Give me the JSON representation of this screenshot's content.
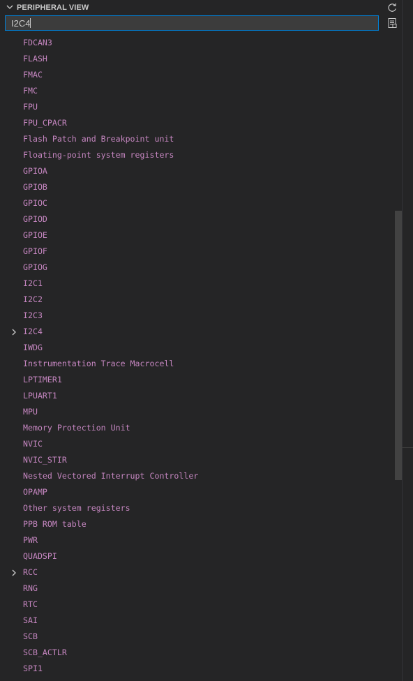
{
  "panel": {
    "title": "PERIPHERAL VIEW",
    "actions": {
      "refresh_icon": "refresh-icon",
      "filter_options_icon": "filter-options-icon"
    }
  },
  "filter": {
    "value": "I2C4",
    "placeholder": ""
  },
  "tree": {
    "items": [
      {
        "label": "FDCAN3",
        "expandable": false
      },
      {
        "label": "FLASH",
        "expandable": false
      },
      {
        "label": "FMAC",
        "expandable": false
      },
      {
        "label": "FMC",
        "expandable": false
      },
      {
        "label": "FPU",
        "expandable": false
      },
      {
        "label": "FPU_CPACR",
        "expandable": false
      },
      {
        "label": "Flash Patch and Breakpoint unit",
        "expandable": false
      },
      {
        "label": "Floating-point system registers",
        "expandable": false
      },
      {
        "label": "GPIOA",
        "expandable": false
      },
      {
        "label": "GPIOB",
        "expandable": false
      },
      {
        "label": "GPIOC",
        "expandable": false
      },
      {
        "label": "GPIOD",
        "expandable": false
      },
      {
        "label": "GPIOE",
        "expandable": false
      },
      {
        "label": "GPIOF",
        "expandable": false
      },
      {
        "label": "GPIOG",
        "expandable": false
      },
      {
        "label": "I2C1",
        "expandable": false
      },
      {
        "label": "I2C2",
        "expandable": false
      },
      {
        "label": "I2C3",
        "expandable": false
      },
      {
        "label": "I2C4",
        "expandable": true
      },
      {
        "label": "IWDG",
        "expandable": false
      },
      {
        "label": "Instrumentation Trace Macrocell",
        "expandable": false
      },
      {
        "label": "LPTIMER1",
        "expandable": false
      },
      {
        "label": "LPUART1",
        "expandable": false
      },
      {
        "label": "MPU",
        "expandable": false
      },
      {
        "label": "Memory Protection Unit",
        "expandable": false
      },
      {
        "label": "NVIC",
        "expandable": false
      },
      {
        "label": "NVIC_STIR",
        "expandable": false
      },
      {
        "label": "Nested Vectored Interrupt Controller",
        "expandable": false
      },
      {
        "label": "OPAMP",
        "expandable": false
      },
      {
        "label": "Other system registers",
        "expandable": false
      },
      {
        "label": "PPB ROM table",
        "expandable": false
      },
      {
        "label": "PWR",
        "expandable": false
      },
      {
        "label": "QUADSPI",
        "expandable": false
      },
      {
        "label": "RCC",
        "expandable": true
      },
      {
        "label": "RNG",
        "expandable": false
      },
      {
        "label": "RTC",
        "expandable": false
      },
      {
        "label": "SAI",
        "expandable": false
      },
      {
        "label": "SCB",
        "expandable": false
      },
      {
        "label": "SCB_ACTLR",
        "expandable": false
      },
      {
        "label": "SPI1",
        "expandable": false
      }
    ]
  },
  "colors": {
    "background": "#252526",
    "item_text": "#c586c0",
    "header_text": "#cccccc",
    "input_border": "#007fd4",
    "input_background": "#3c3c3c",
    "scrollbar_thumb": "#424242"
  }
}
